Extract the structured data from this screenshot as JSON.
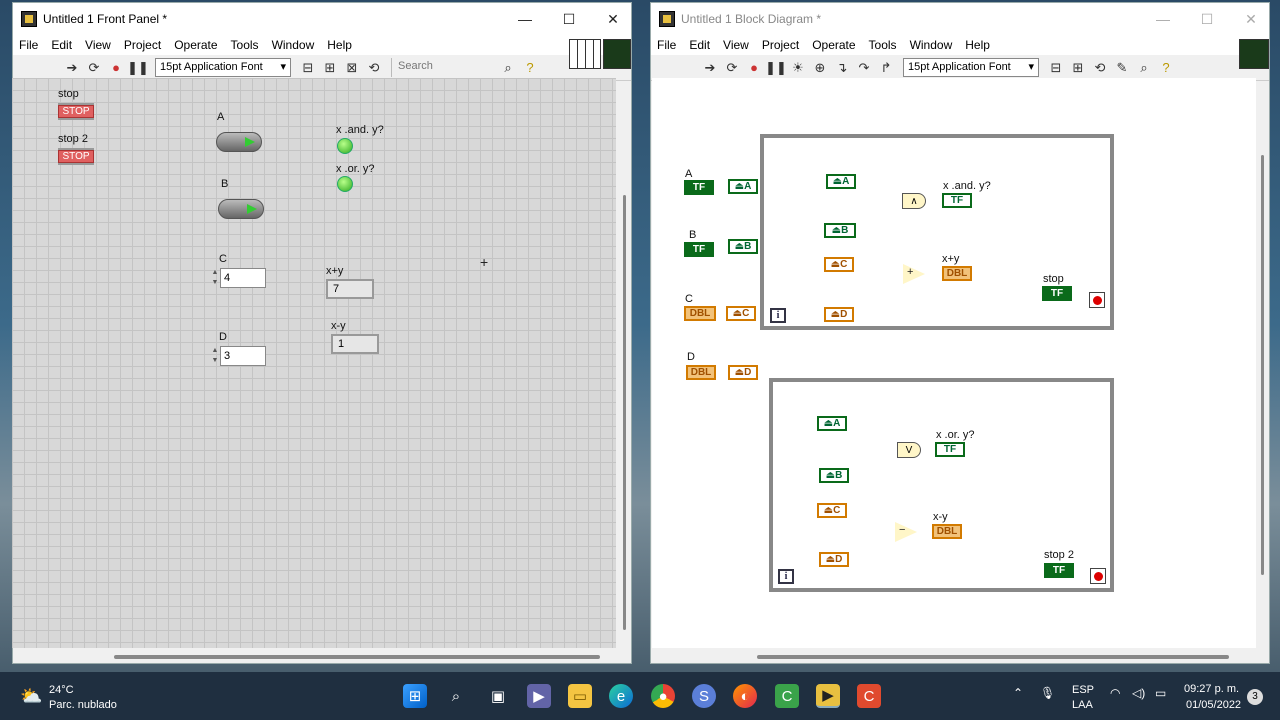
{
  "front_panel": {
    "title": "Untitled 1 Front Panel *",
    "menu": [
      "File",
      "Edit",
      "View",
      "Project",
      "Operate",
      "Tools",
      "Window",
      "Help"
    ],
    "font": "15pt Application Font",
    "search_placeholder": "Search",
    "controls": {
      "stop_label": "stop",
      "stop_text": "STOP",
      "stop2_label": "stop 2",
      "stop2_text": "STOP",
      "a_label": "A",
      "b_label": "B",
      "and_label": "x .and. y?",
      "or_label": "x .or. y?",
      "c_label": "C",
      "c_value": "4",
      "d_label": "D",
      "d_value": "3",
      "sum_label": "x+y",
      "sum_value": "7",
      "diff_label": "x-y",
      "diff_value": "1"
    }
  },
  "block_diagram": {
    "title": "Untitled 1 Block Diagram *",
    "menu": [
      "File",
      "Edit",
      "View",
      "Project",
      "Operate",
      "Tools",
      "Window",
      "Help"
    ],
    "font": "15pt Application Font",
    "labels": {
      "a": "A",
      "b": "B",
      "c": "C",
      "d": "D",
      "and_out": "x .and. y?",
      "sum_out": "x+y",
      "stop": "stop",
      "or_out": "x .or. y?",
      "diff_out": "x-y",
      "stop2": "stop 2"
    },
    "terms": {
      "tf": "TF",
      "dbl": "DBL",
      "ref_a": "A",
      "ref_b": "B",
      "ref_c": "C",
      "ref_d": "D",
      "and_sym": "∧",
      "or_sym": "V",
      "plus": "+",
      "minus": "−",
      "loop_i": "i"
    }
  },
  "taskbar": {
    "temperature": "24°C",
    "weather": "Parc. nublado",
    "lang1": "ESP",
    "lang2": "LAA",
    "time": "09:27 p. m.",
    "date": "01/05/2022",
    "notifications": "3"
  },
  "colors": {
    "boolean_wire": "#1a7a2a",
    "numeric_wire": "#d27a00"
  }
}
